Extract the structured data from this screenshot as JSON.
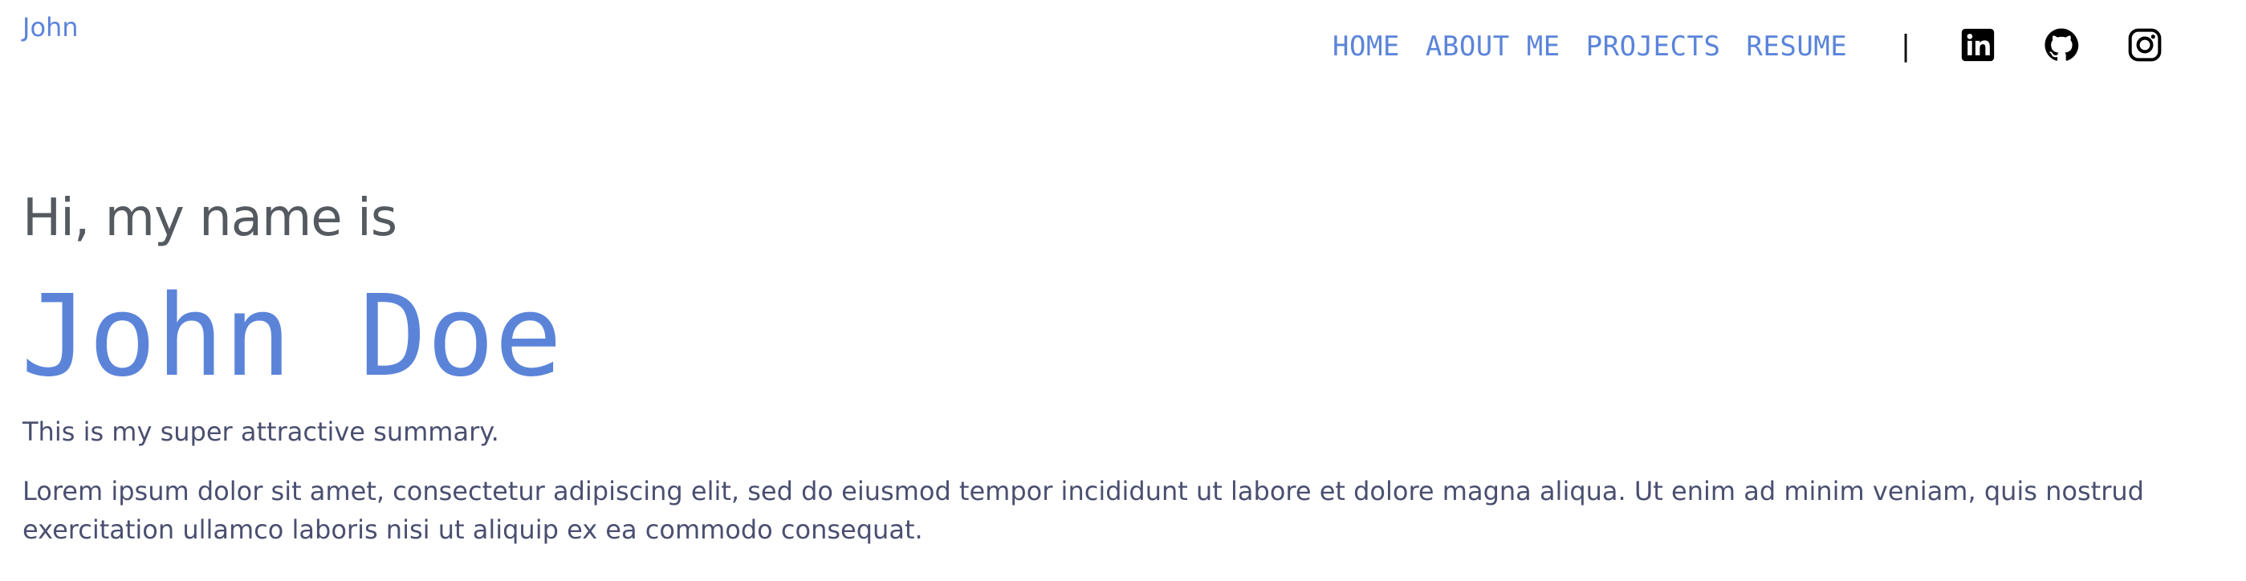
{
  "header": {
    "brand": "John",
    "nav": [
      {
        "label": "HOME"
      },
      {
        "label": "ABOUT ME"
      },
      {
        "label": "PROJECTS"
      },
      {
        "label": "RESUME"
      }
    ],
    "divider": "|",
    "social": [
      {
        "icon": "linkedin-icon"
      },
      {
        "icon": "github-icon"
      },
      {
        "icon": "instagram-icon"
      }
    ]
  },
  "hero": {
    "greeting": "Hi, my name is",
    "name": "John Doe",
    "summary": "This is my super attractive summary.",
    "description": "Lorem ipsum dolor sit amet, consectetur adipiscing elit, sed do eiusmod tempor incididunt ut labore et dolore magna aliqua. Ut enim ad minim veniam, quis nostrud exercitation ullamco laboris nisi ut aliquip ex ea commodo consequat."
  },
  "colors": {
    "accent": "#5b84d9",
    "heading": "#555a60",
    "body_text": "#4a4f70",
    "icon": "#000000"
  }
}
